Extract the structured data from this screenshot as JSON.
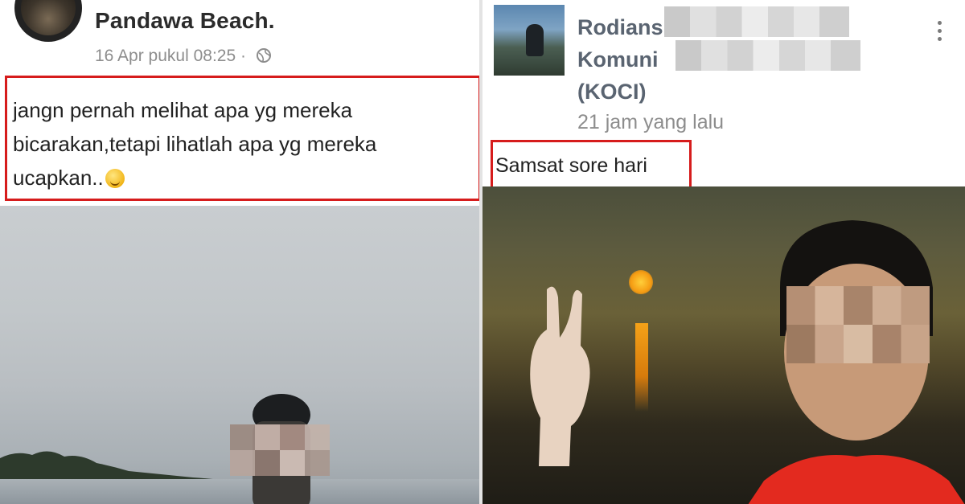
{
  "left_post": {
    "place_name": "Pandawa Beach.",
    "timestamp": "16 Apr pukul 08:25",
    "separator": "·",
    "privacy_icon": "globe-icon",
    "caption_line1": "jangn pernah melihat apa yg mereka",
    "caption_line2": "bicarakan,tetapi lihatlah apa yg mereka",
    "caption_line3": "ucapkan..",
    "emoji": "smirk-emoji",
    "photo": "beach-photo"
  },
  "right_post": {
    "name_line1": "Rodians",
    "name_line2": "Komuni",
    "name_line3": "(KOCI)",
    "timestamp": "21 jam yang lalu",
    "menu_icon": "kebab-menu-icon",
    "caption": "Samsat sore hari",
    "photo": "sunset-photo"
  },
  "colors": {
    "highlight_border": "#d61c1c",
    "name_text": "#5a6471",
    "meta_text": "#8d8d8d"
  }
}
